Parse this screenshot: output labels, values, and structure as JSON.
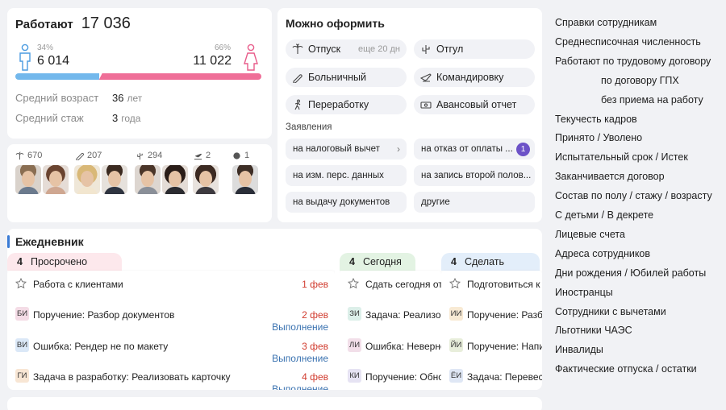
{
  "stats": {
    "label": "Работают",
    "total": "17 036",
    "male": {
      "pct": "34%",
      "count": "6 014",
      "share": 0.34
    },
    "female": {
      "pct": "66%",
      "count": "11 022",
      "share": 0.66
    },
    "avg_age_label": "Средний возраст",
    "avg_age_value": "36",
    "avg_age_unit": "лет",
    "avg_tenure_label": "Средний стаж",
    "avg_tenure_value": "3",
    "avg_tenure_unit": "года",
    "colors": {
      "male": "#73b8ec",
      "female": "#ef6f98"
    }
  },
  "absences": [
    {
      "icon": "vacation-icon",
      "count": "670"
    },
    {
      "icon": "sick-leave-icon",
      "count": "207"
    },
    {
      "icon": "cactus-icon",
      "count": "294"
    },
    {
      "icon": "plane-icon",
      "count": "2"
    },
    {
      "icon": "overtime-icon",
      "count": "1"
    }
  ],
  "apply": {
    "title": "Можно оформить",
    "items": [
      {
        "label": "Отпуск",
        "hint": "еще 20 дн",
        "icon": "palm-icon"
      },
      {
        "label": "Отгул",
        "icon": "cactus-icon"
      },
      {
        "label": "Больничный",
        "icon": "thermometer-icon"
      },
      {
        "label": "Командировку",
        "icon": "plane-icon"
      },
      {
        "label": "Переработку",
        "icon": "running-icon"
      },
      {
        "label": "Авансовый отчет",
        "icon": "money-icon"
      }
    ],
    "applications_title": "Заявления",
    "applications": [
      {
        "label": "на налоговый вычет",
        "chevron": "›"
      },
      {
        "label": "на отказ от оплаты ...",
        "badge": "1"
      },
      {
        "label": "на изм. перс. данных"
      },
      {
        "label": "на запись второй полов..."
      },
      {
        "label": "на выдачу документов"
      },
      {
        "label": "другие"
      }
    ]
  },
  "diary": {
    "title": "Ежедневник",
    "columns": [
      {
        "count": "4",
        "label": "Просрочено",
        "color": "#fde8ec",
        "tasks": [
          {
            "star": true,
            "text": "Работа с клиентами",
            "date": "1 фев"
          },
          {
            "tag": "БИ",
            "tag_color": "#f4dce6",
            "text": "Поручение: Разбор документов",
            "date": "2 фев",
            "status": "Выполнение"
          },
          {
            "tag": "ВИ",
            "tag_color": "#dbe8f7",
            "text": "Ошибка: Рендер не по макету",
            "date": "3 фев",
            "status": "Выполнение"
          },
          {
            "tag": "ГИ",
            "tag_color": "#f8e6d4",
            "text": "Задача в разработку: Реализовать карточку",
            "date": "4 фев",
            "status": "Выполнение"
          }
        ]
      },
      {
        "count": "4",
        "label": "Сегодня",
        "color": "#e3f3e3",
        "tasks": [
          {
            "star": true,
            "text": "Сдать сегодня отчет"
          },
          {
            "tag": "ЗИ",
            "tag_color": "#dcefe9",
            "text": "Задача: Реализовать"
          },
          {
            "tag": "ЛИ",
            "tag_color": "#f2dfe9",
            "text": "Ошибка: Неверное"
          },
          {
            "tag": "КИ",
            "tag_color": "#e6e3f3",
            "text": "Поручение: Обнов"
          }
        ]
      },
      {
        "count": "4",
        "label": "Сделать",
        "color": "#e3eefa",
        "tasks": [
          {
            "star": true,
            "text": "Подготовиться к с"
          },
          {
            "tag": "ИИ",
            "tag_color": "#f8ead4",
            "text": "Поручение: Разбор"
          },
          {
            "tag": "ЙИ",
            "tag_color": "#e8eedb",
            "text": "Поручение: Напис"
          },
          {
            "tag": "ЁИ",
            "tag_color": "#dfe7f5",
            "text": "Задача: Перевести"
          }
        ]
      }
    ]
  },
  "links": [
    {
      "label": "Справки сотрудникам",
      "indent": false
    },
    {
      "label": "Среднесписочная численность",
      "indent": false
    },
    {
      "label": "Работают по трудовому договору",
      "indent": false
    },
    {
      "label": "по договору ГПХ",
      "indent": true
    },
    {
      "label": "без приема на работу",
      "indent": true
    },
    {
      "label": "Текучесть кадров",
      "indent": false
    },
    {
      "label": "Принято / Уволено",
      "indent": false
    },
    {
      "label": "Испытательный срок / Истек",
      "indent": false
    },
    {
      "label": "Заканчивается договор",
      "indent": false
    },
    {
      "label": "Состав по полу / стажу / возрасту",
      "indent": false
    },
    {
      "label": "С детьми / В декрете",
      "indent": false
    },
    {
      "label": "Лицевые счета",
      "indent": false
    },
    {
      "label": "Адреса сотрудников",
      "indent": false
    },
    {
      "label": "Дни рождения / Юбилей работы",
      "indent": false
    },
    {
      "label": "Иностранцы",
      "indent": false
    },
    {
      "label": "Сотрудники с вычетами",
      "indent": false
    },
    {
      "label": "Льготники ЧАЭС",
      "indent": false
    },
    {
      "label": "Инвалиды",
      "indent": false
    },
    {
      "label": "Фактические отпуска / остатки",
      "indent": false
    }
  ]
}
